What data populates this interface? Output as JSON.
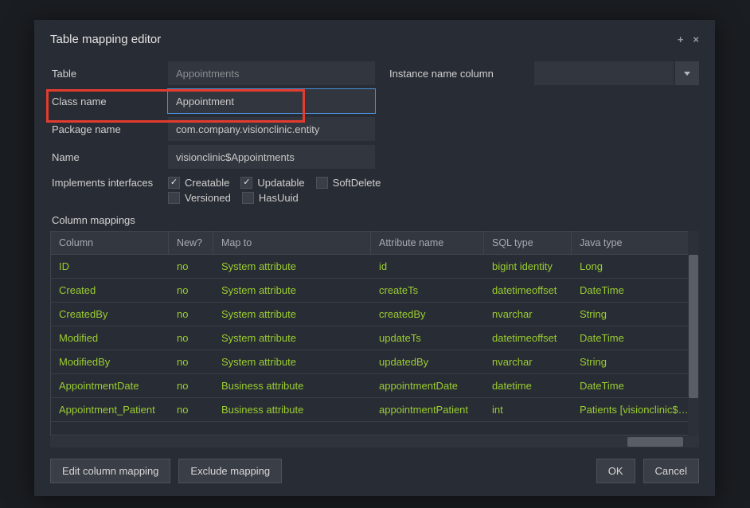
{
  "modal": {
    "title": "Table mapping editor"
  },
  "form": {
    "table_label": "Table",
    "table_value": "Appointments",
    "classname_label": "Class name",
    "classname_value": "Appointment",
    "package_label": "Package name",
    "package_value": "com.company.visionclinic.entity",
    "name_label": "Name",
    "name_value": "visionclinic$Appointments",
    "instance_label": "Instance name column",
    "instance_value": "",
    "implements_label": "Implements interfaces",
    "checks": {
      "creatable": "Creatable",
      "updatable": "Updatable",
      "softdelete": "SoftDelete",
      "versioned": "Versioned",
      "hasuuid": "HasUuid"
    }
  },
  "grid": {
    "section": "Column mappings",
    "headers": {
      "column": "Column",
      "new": "New?",
      "mapto": "Map to",
      "attr": "Attribute name",
      "sql": "SQL type",
      "java": "Java type"
    },
    "rows": [
      {
        "col": "ID",
        "new": "no",
        "map": "System attribute",
        "attr": "id",
        "sql": "bigint identity",
        "java": "Long"
      },
      {
        "col": "Created",
        "new": "no",
        "map": "System attribute",
        "attr": "createTs",
        "sql": "datetimeoffset",
        "java": "DateTime"
      },
      {
        "col": "CreatedBy",
        "new": "no",
        "map": "System attribute",
        "attr": "createdBy",
        "sql": "nvarchar",
        "java": "String"
      },
      {
        "col": "Modified",
        "new": "no",
        "map": "System attribute",
        "attr": "updateTs",
        "sql": "datetimeoffset",
        "java": "DateTime"
      },
      {
        "col": "ModifiedBy",
        "new": "no",
        "map": "System attribute",
        "attr": "updatedBy",
        "sql": "nvarchar",
        "java": "String"
      },
      {
        "col": "AppointmentDate",
        "new": "no",
        "map": "Business attribute",
        "attr": "appointmentDate",
        "sql": "datetime",
        "java": "DateTime"
      },
      {
        "col": "Appointment_Patient",
        "new": "no",
        "map": "Business attribute",
        "attr": "appointmentPatient",
        "sql": "int",
        "java": "Patients [visionclinic$Patients]"
      }
    ]
  },
  "footer": {
    "edit": "Edit column mapping",
    "exclude": "Exclude mapping",
    "ok": "OK",
    "cancel": "Cancel"
  }
}
